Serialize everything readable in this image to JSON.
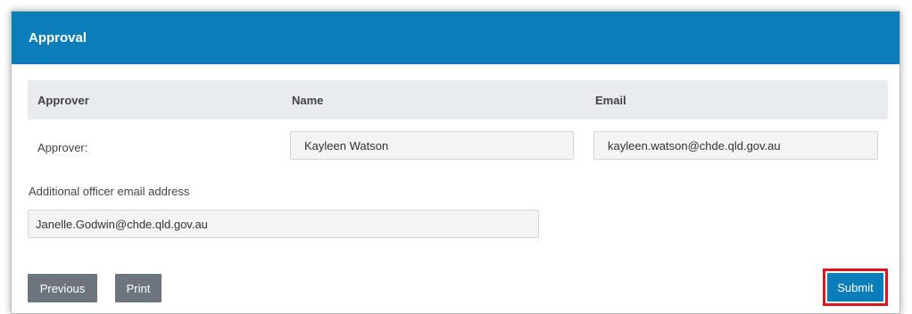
{
  "panel": {
    "title": "Approval"
  },
  "table": {
    "headers": [
      "Approver",
      "Name",
      "Email"
    ],
    "row": {
      "label": "Approver:",
      "name": "Kayleen Watson",
      "email": "kayleen.watson@chde.qld.gov.au"
    }
  },
  "additional": {
    "label": "Additional officer email address",
    "value": "Janelle.Godwin@chde.qld.gov.au"
  },
  "buttons": {
    "previous": "Previous",
    "print": "Print",
    "submit": "Submit"
  },
  "colors": {
    "header": "#0b7db8",
    "submit": "#0b7db8",
    "grey_button": "#6c757d",
    "highlight": "#e0131e"
  }
}
